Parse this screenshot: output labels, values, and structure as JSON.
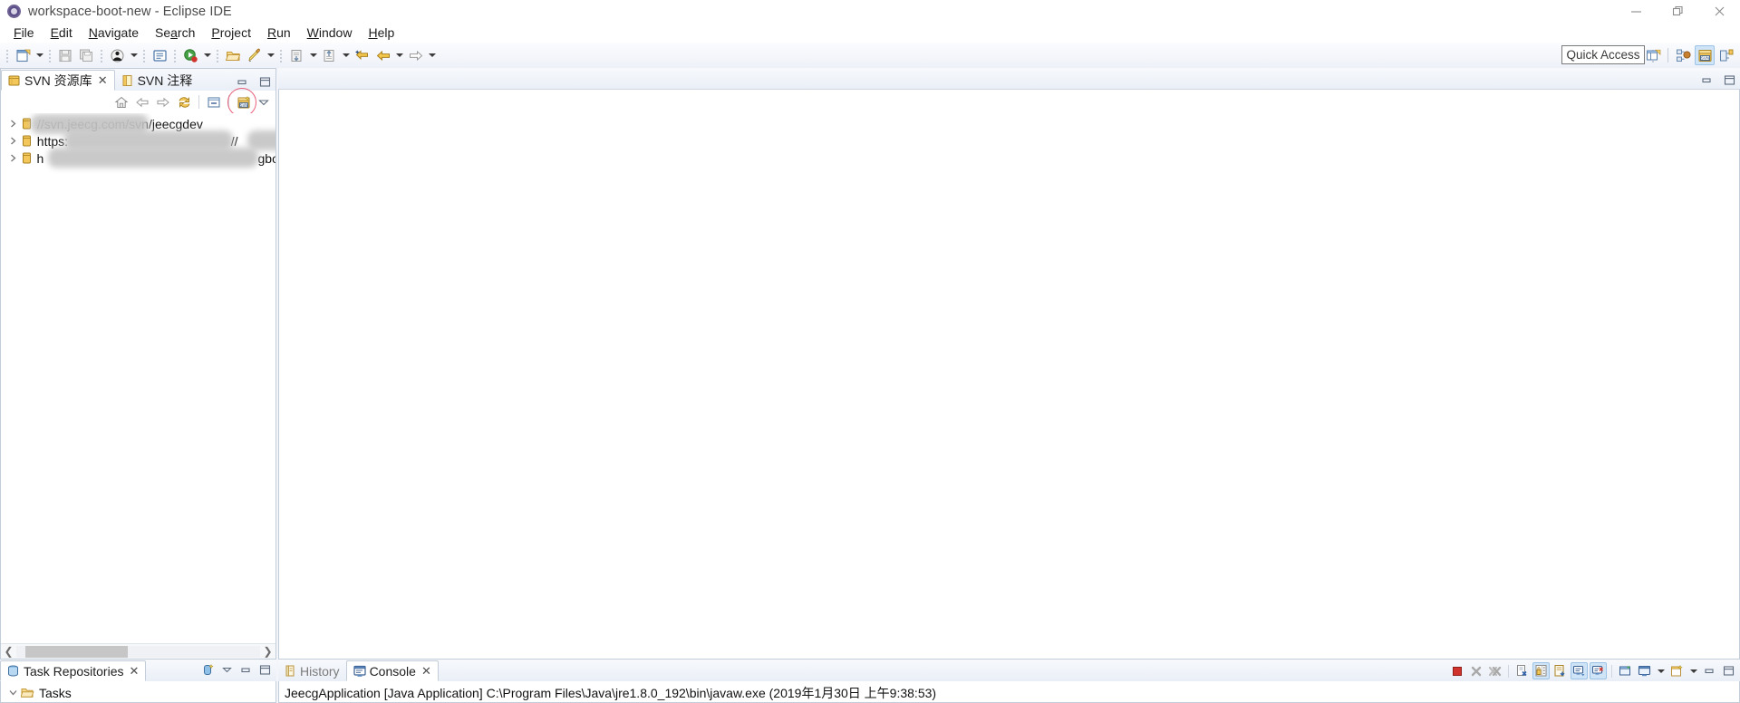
{
  "window": {
    "title": "workspace-boot-new - Eclipse IDE",
    "app_icon": "eclipse-icon",
    "minimize_label": "Minimize",
    "restore_label": "Restore",
    "close_label": "Close"
  },
  "menubar": {
    "items": [
      {
        "label": "File",
        "mnemonic": "F"
      },
      {
        "label": "Edit",
        "mnemonic": "E"
      },
      {
        "label": "Navigate",
        "mnemonic": "N"
      },
      {
        "label": "Search",
        "mnemonic": "a"
      },
      {
        "label": "Project",
        "mnemonic": "P"
      },
      {
        "label": "Run",
        "mnemonic": "R"
      },
      {
        "label": "Window",
        "mnemonic": "W"
      },
      {
        "label": "Help",
        "mnemonic": "H"
      }
    ]
  },
  "toolbar": {
    "buttons": [
      {
        "name": "new-wizard-button",
        "icon": "new-file-icon",
        "dropdown": true
      },
      {
        "name": "save-button",
        "icon": "save-icon",
        "dropdown": false
      },
      {
        "name": "save-all-button",
        "icon": "save-all-icon",
        "dropdown": false
      },
      {
        "name": "debug-button",
        "icon": "debug-icon",
        "dropdown": true
      },
      {
        "name": "open-console-button",
        "icon": "console-icon",
        "dropdown": false
      },
      {
        "name": "run-button",
        "icon": "run-icon",
        "dropdown": true
      },
      {
        "name": "open-type-button",
        "icon": "open-folder-icon",
        "dropdown": false
      },
      {
        "name": "marker-button",
        "icon": "marker-icon",
        "dropdown": true
      },
      {
        "name": "import-button",
        "icon": "import-icon",
        "dropdown": true
      },
      {
        "name": "export-button",
        "icon": "export-icon",
        "dropdown": true
      },
      {
        "name": "last-edit-button",
        "icon": "last-edit-icon",
        "dropdown": false
      },
      {
        "name": "back-button",
        "icon": "back-arrow-icon",
        "dropdown": true
      },
      {
        "name": "forward-button",
        "icon": "forward-arrow-icon",
        "dropdown": true
      }
    ],
    "quick_access": {
      "label": "Quick Access",
      "placeholder": "Quick Access"
    },
    "perspectives": [
      {
        "name": "open-perspective-button",
        "icon": "open-perspective-icon",
        "active": false
      },
      {
        "name": "perspective-java-button",
        "icon": "java-perspective-icon",
        "active": false
      },
      {
        "name": "perspective-svn-button",
        "icon": "svn-perspective-icon",
        "active": true
      },
      {
        "name": "perspective-other-button",
        "icon": "other-perspective-icon",
        "active": false
      }
    ]
  },
  "svn_view": {
    "tabs": [
      {
        "label": "SVN 资源库",
        "icon": "svn-repository-icon",
        "active": true,
        "closable": true
      },
      {
        "label": "SVN 注释",
        "icon": "svn-annotate-icon",
        "active": false,
        "closable": false
      }
    ],
    "view_toolbar": [
      {
        "name": "home-button",
        "icon": "home-icon",
        "highlighted": false
      },
      {
        "name": "back-button",
        "icon": "back-arrow-icon",
        "highlighted": false
      },
      {
        "name": "forward-button",
        "icon": "forward-arrow-icon",
        "highlighted": false
      },
      {
        "name": "refresh-button",
        "icon": "refresh-icon",
        "highlighted": false
      },
      {
        "name": "collapse-all-button",
        "icon": "collapse-all-icon",
        "highlighted": false
      },
      {
        "name": "new-repository-location-button",
        "icon": "new-repository-icon",
        "highlighted": true
      },
      {
        "name": "view-menu-button",
        "icon": "view-menu-icon",
        "highlighted": false
      }
    ],
    "tree_items": [
      {
        "label": "//svn.jeecg.com/svn/jeecgdev",
        "icon": "repository-icon",
        "expanded": false,
        "redacted": true
      },
      {
        "label": "https:",
        "suffix": "//",
        "icon": "repository-icon",
        "expanded": false,
        "redacted": true
      },
      {
        "label": "h",
        "suffix": "gbo",
        "icon": "repository-icon",
        "expanded": false,
        "redacted": true
      }
    ],
    "minimize_label": "Minimize",
    "maximize_label": "Maximize"
  },
  "editor": {
    "minimize_label": "Minimize",
    "maximize_label": "Maximize",
    "content": ""
  },
  "task_repositories": {
    "tabs": [
      {
        "label": "Task Repositories",
        "icon": "task-repository-icon",
        "active": true,
        "closable": true
      }
    ],
    "toolbar": [
      {
        "name": "add-task-repository-button",
        "icon": "add-repository-icon"
      },
      {
        "name": "view-menu-button",
        "icon": "view-menu-icon"
      },
      {
        "name": "minimize-button",
        "icon": "minimize-icon"
      },
      {
        "name": "maximize-button",
        "icon": "maximize-icon"
      }
    ],
    "tree_items": [
      {
        "label": "Tasks",
        "icon": "folder-icon",
        "expanded": true
      }
    ]
  },
  "console": {
    "tabs": [
      {
        "label": "History",
        "icon": "history-icon",
        "active": false,
        "closable": false
      },
      {
        "label": "Console",
        "icon": "console-icon",
        "active": true,
        "closable": true
      }
    ],
    "process_line": "JeecgApplication [Java Application] C:\\Program Files\\Java\\jre1.8.0_192\\bin\\javaw.exe (2019年1月30日 上午9:38:53)",
    "toolbar": [
      {
        "name": "terminate-button",
        "icon": "stop-icon",
        "enabled": true,
        "toggled": false
      },
      {
        "name": "remove-launch-button",
        "icon": "remove-icon",
        "enabled": false,
        "toggled": false
      },
      {
        "name": "remove-all-terminated-button",
        "icon": "remove-all-icon",
        "enabled": false,
        "toggled": false
      },
      {
        "name": "clear-console-button",
        "icon": "clear-console-icon",
        "enabled": true,
        "toggled": false
      },
      {
        "name": "scroll-lock-button",
        "icon": "lock-icon",
        "enabled": true,
        "toggled": true
      },
      {
        "name": "word-wrap-button",
        "icon": "word-wrap-icon",
        "enabled": true,
        "toggled": false
      },
      {
        "name": "show-console-on-output-button",
        "icon": "show-console-out-icon",
        "enabled": true,
        "toggled": true
      },
      {
        "name": "show-console-on-error-button",
        "icon": "show-console-err-icon",
        "enabled": true,
        "toggled": true
      },
      {
        "name": "pin-console-button",
        "icon": "pin-console-icon",
        "enabled": true,
        "toggled": false
      },
      {
        "name": "display-selected-console-button",
        "icon": "display-console-icon",
        "enabled": true,
        "toggled": false,
        "dropdown": true
      },
      {
        "name": "open-console-button",
        "icon": "new-console-icon",
        "enabled": true,
        "toggled": false,
        "dropdown": true
      },
      {
        "name": "minimize-button",
        "icon": "minimize-icon",
        "enabled": true,
        "toggled": false
      },
      {
        "name": "maximize-button",
        "icon": "maximize-icon",
        "enabled": true,
        "toggled": false
      }
    ]
  },
  "colors": {
    "accent": "#cfe4f7",
    "highlight_circle": "#e8607a",
    "border": "#c3cdd9",
    "tab_gradient_top": "#f7f9fc",
    "tab_gradient_bottom": "#eaeff7"
  }
}
